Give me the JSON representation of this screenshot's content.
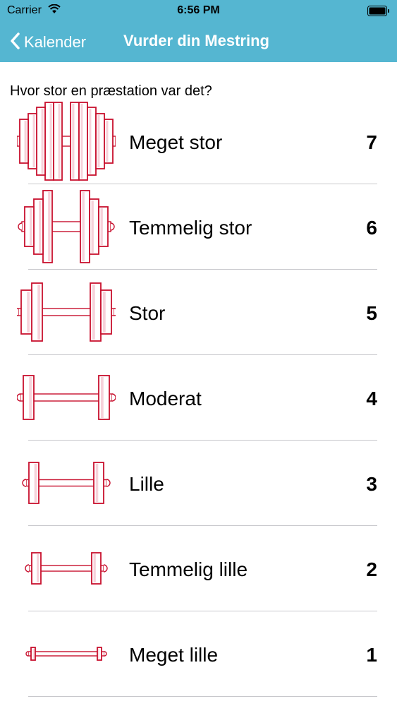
{
  "status_bar": {
    "carrier": "Carrier",
    "time": "6:56 PM",
    "wifi_icon": "wifi-icon",
    "battery_icon": "battery-icon"
  },
  "nav_bar": {
    "back_label": "Kalender",
    "back_icon": "chevron-left-icon",
    "title": "Vurder din Mestring",
    "background_color": "#55b6d1",
    "text_color": "#ffffff"
  },
  "question": "Hvor stor en præstation var det?",
  "icon_color": "#c8102e",
  "ratings": [
    {
      "label": "Meget stor",
      "value": "7",
      "icon": "dumbbell-icon"
    },
    {
      "label": "Temmelig stor",
      "value": "6",
      "icon": "dumbbell-icon"
    },
    {
      "label": "Stor",
      "value": "5",
      "icon": "dumbbell-icon"
    },
    {
      "label": "Moderat",
      "value": "4",
      "icon": "dumbbell-icon"
    },
    {
      "label": "Lille",
      "value": "3",
      "icon": "dumbbell-icon"
    },
    {
      "label": "Temmelig lille",
      "value": "2",
      "icon": "dumbbell-icon"
    },
    {
      "label": "Meget lille",
      "value": "1",
      "icon": "dumbbell-icon"
    }
  ]
}
